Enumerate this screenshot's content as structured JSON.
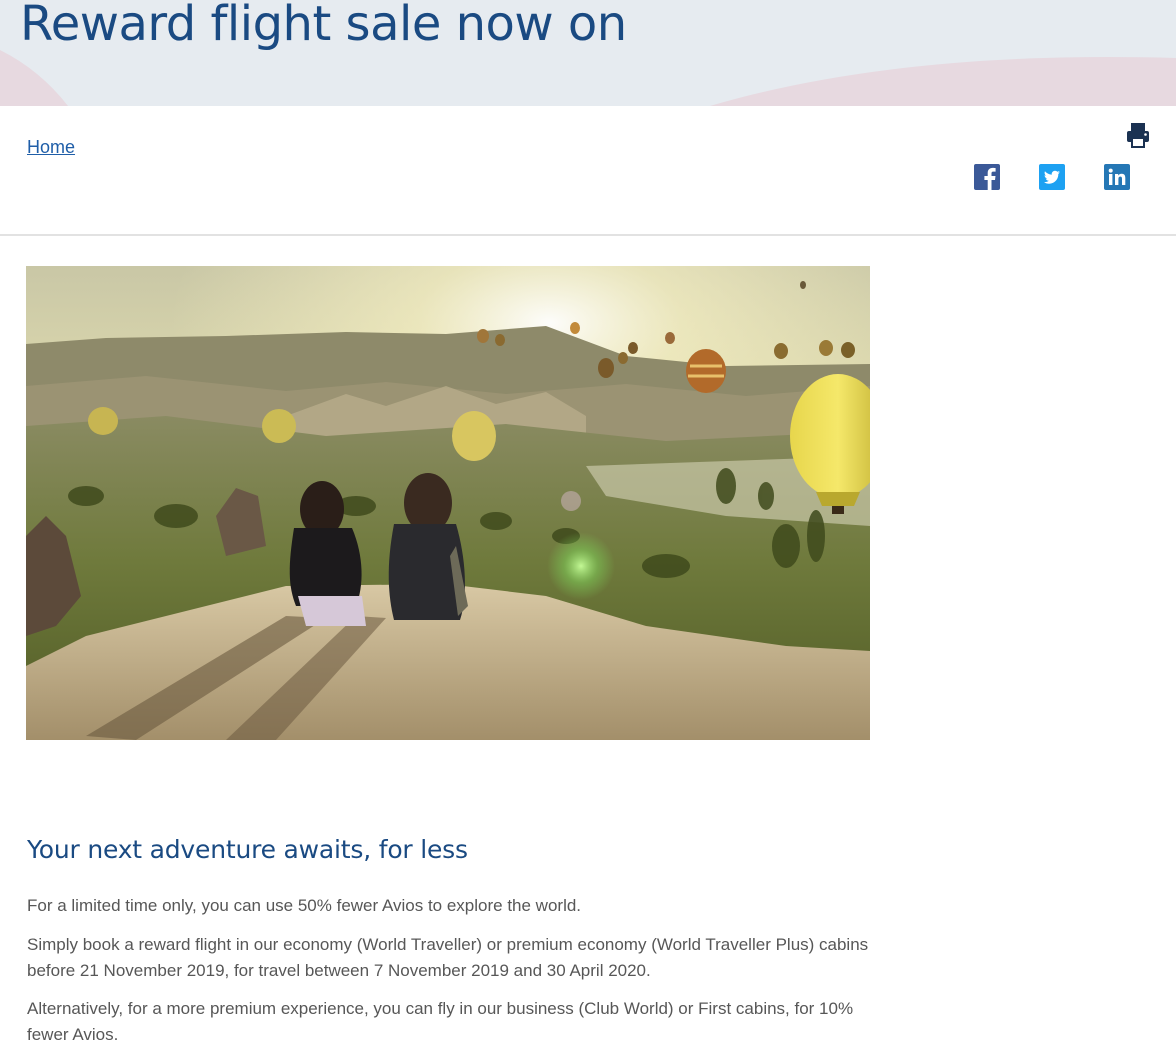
{
  "header": {
    "title": "Reward flight sale now on"
  },
  "breadcrumb": {
    "home_label": "Home"
  },
  "toolbar": {
    "print_icon": "printer-icon",
    "share_icons": [
      "facebook-icon",
      "twitter-icon",
      "linkedin-icon"
    ]
  },
  "hero_image": {
    "subject": "two people watching hot air balloons at sunrise over a valley"
  },
  "content": {
    "heading": "Your next adventure awaits, for less",
    "paragraphs": [
      "For a limited time only, you can use 50% fewer Avios to explore the world.",
      "Simply book a reward flight in our economy (World Traveller) or premium economy (World Traveller Plus) cabins before 21 November 2019, for travel between 7 November 2019 and 30 April 2020.",
      "Alternatively, for a more premium experience, you can fly in our business (Club World) or First cabins, for 10% fewer Avios."
    ]
  },
  "colors": {
    "brand_blue": "#1a4a82",
    "link_blue": "#1f5ea8",
    "facebook": "#3b5998",
    "twitter": "#1da1f2",
    "linkedin": "#2577b5",
    "hero_bg": "#e6ebf0"
  }
}
